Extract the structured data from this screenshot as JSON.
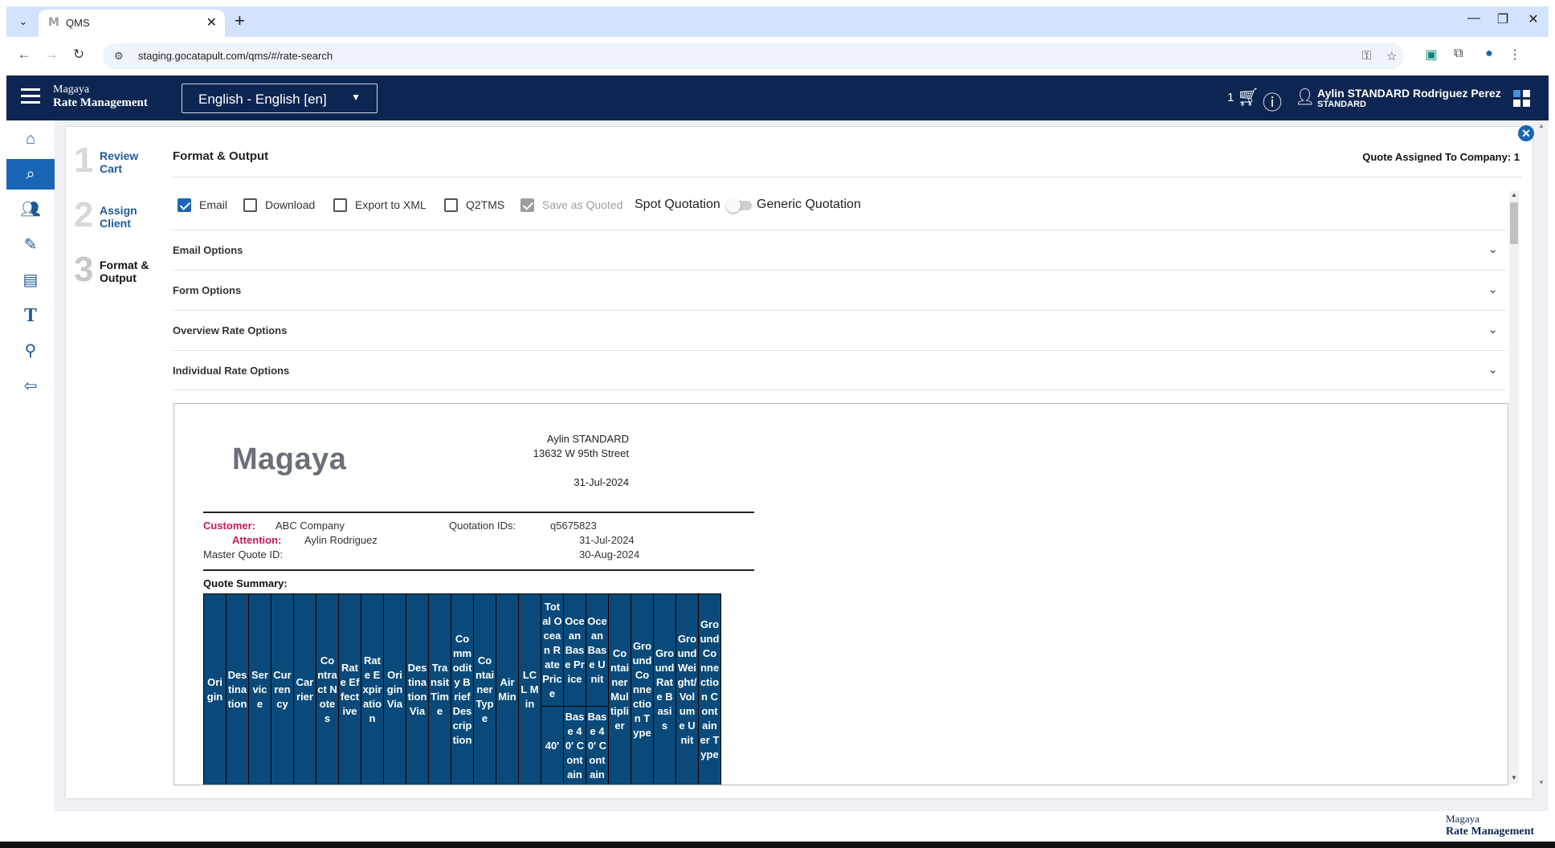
{
  "browser": {
    "tab_title": "QMS",
    "url": "staging.gocatapult.com/qms/#/rate-search"
  },
  "app": {
    "brand_line1": "Magaya",
    "brand_line2": "Rate Management",
    "language": "English - English [en]",
    "cart_count": "1",
    "user_name": "Aylin STANDARD Rodriguez Perez",
    "user_role": "STANDARD"
  },
  "steps": [
    {
      "num": "1",
      "label": "Review Cart"
    },
    {
      "num": "2",
      "label": "Assign Client"
    },
    {
      "num": "3",
      "label": "Format & Output"
    }
  ],
  "main": {
    "title": "Format & Output",
    "quote_assigned": "Quote Assigned To Company: 1",
    "options": [
      {
        "label": "Email",
        "checked": true
      },
      {
        "label": "Download",
        "checked": false
      },
      {
        "label": "Export to XML",
        "checked": false
      },
      {
        "label": "Q2TMS",
        "checked": false
      },
      {
        "label": "Save as Quoted",
        "checked": true,
        "disabled": true
      }
    ],
    "spot_quotation": "Spot Quotation",
    "generic_quotation": "Generic Quotation",
    "accordions": [
      "Email Options",
      "Form Options",
      "Overview Rate Options",
      "Individual Rate Options"
    ]
  },
  "preview": {
    "logo": "Magaya",
    "sender_name": "Aylin STANDARD",
    "sender_address": "13632 W 95th Street",
    "date": "31-Jul-2024",
    "customer_label": "Customer:",
    "customer_value": "ABC Company",
    "attention_label": "Attention:",
    "attention_value": "Aylin Rodriguez",
    "master_quote_label": "Master Quote ID:",
    "quotation_ids_label": "Quotation IDs:",
    "quotation_id": "q5675823",
    "issue_date": "31-Jul-2024",
    "expiry_date": "30-Aug-2024",
    "summary_label": "Quote Summary:",
    "table_headers": [
      "Origin",
      "Destination",
      "Service",
      "Currency",
      "Carrier",
      "Contract Notes",
      "Rate Effective",
      "Rate Expiration",
      "Origin Via",
      "Destination Via",
      "Transit Time",
      "Commodity Brief Description",
      "Container Type",
      "Air Min",
      "LCL Min",
      "Total Ocean Rate Price",
      "Ocean Base Price",
      "Ocean Base Unit",
      "Container Multiplier",
      "Ground Connection Type",
      "Ground Rate Basis",
      "Ground Weight/Volume Unit",
      "Ground Connection Container Type"
    ],
    "sub_headers": [
      "40'",
      "Base 40' Contain",
      "Base 40' Contain"
    ]
  },
  "footer": {
    "brand_line1": "Magaya",
    "brand_line2": "Rate Management"
  },
  "colors": {
    "header_bg": "#0d2551",
    "accent": "#1a65b5",
    "table_header": "#0a4a7a",
    "label_red": "#c2185b"
  }
}
